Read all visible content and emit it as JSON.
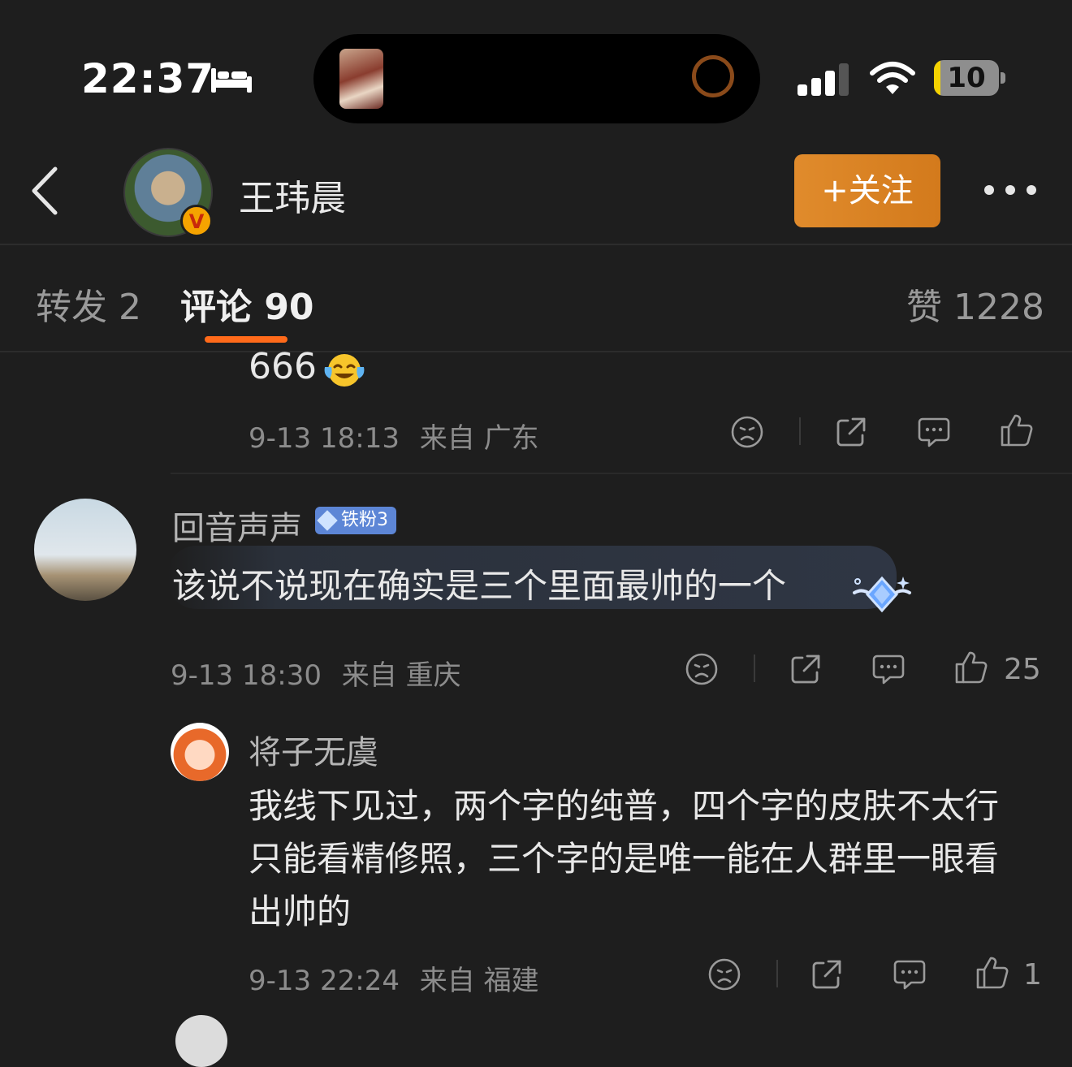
{
  "status_bar": {
    "time": "22:37",
    "battery_level": "10",
    "battery_fraction": 0.1,
    "accent_color": "#f5d300"
  },
  "profile_header": {
    "username": "王玮晨",
    "verified_mark": "V",
    "follow_label": "+关注",
    "follow_color": "#e08b2c"
  },
  "tabs": {
    "repost_label": "转发 2",
    "comment_label": "评论 90",
    "like_label": "赞 1228",
    "active_indicator_color": "#ff6a1a"
  },
  "comments": [
    {
      "text": "666",
      "emoji_icon": "laughing-tears-icon",
      "date": "9-13 18:13",
      "location": "来自 广东",
      "like_count": ""
    },
    {
      "username": "回音声声",
      "fan_badge": "铁粉3",
      "text": "该说不说现在确实是三个里面最帅的一个",
      "date": "9-13 18:30",
      "location": "来自 重庆",
      "like_count": "25"
    }
  ],
  "replies": [
    {
      "username": "将子无虞",
      "text": "我线下见过，两个字的纯普，四个字的皮肤不太行只能看精修照，三个字的是唯一能在人群里一眼看出帅的",
      "date": "9-13 22:24",
      "location": "来自 福建",
      "like_count": "1"
    }
  ],
  "icons": {
    "dislike": "sad-face-icon",
    "share": "share-icon",
    "comment": "comment-bubble-icon",
    "like": "thumbs-up-icon"
  }
}
